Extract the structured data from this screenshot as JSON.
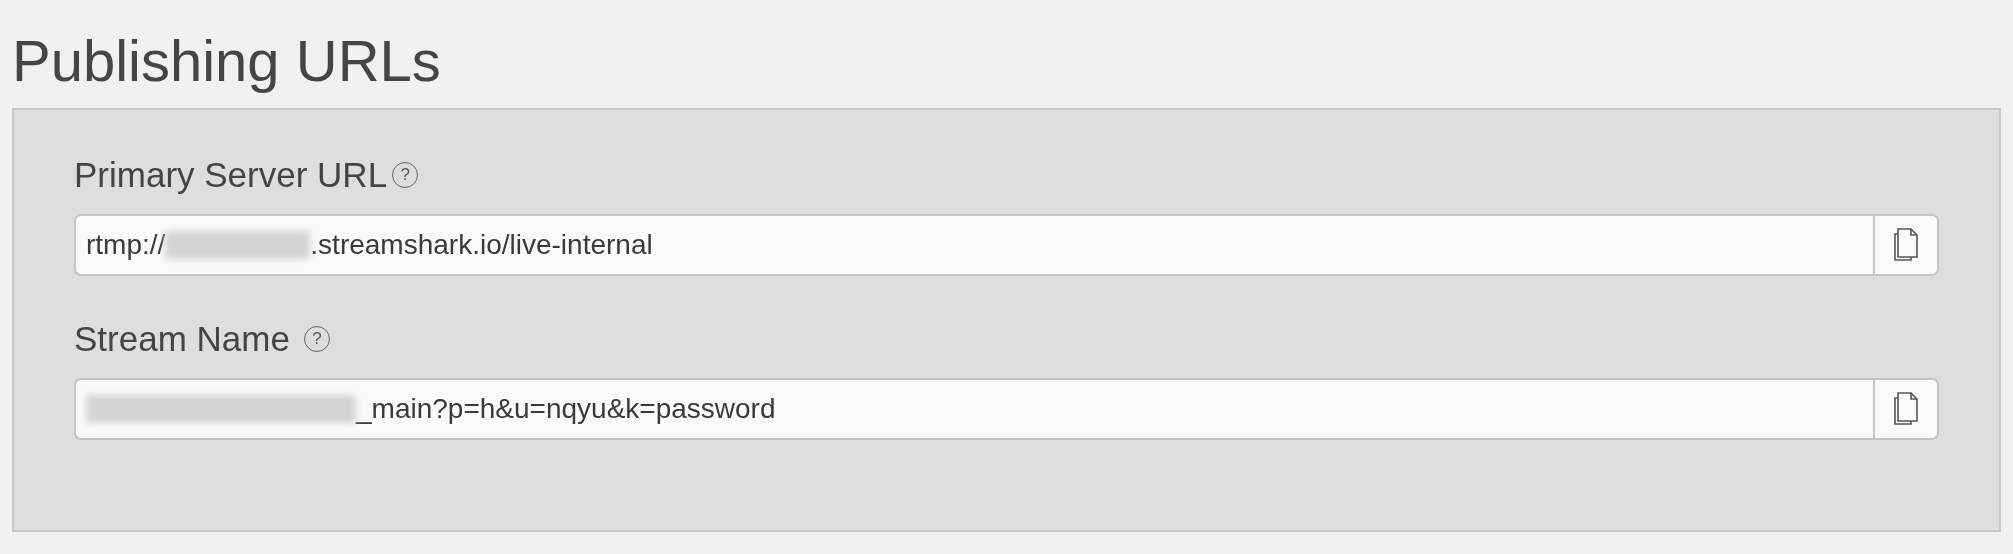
{
  "page_title": "Publishing URLs",
  "fields": [
    {
      "label": "Primary Server URL",
      "help": "?",
      "value_before": "rtmp://",
      "redacted": true,
      "value_after": ".streamshark.io/live-internal",
      "copy_button": true
    },
    {
      "label": "Stream Name",
      "help": "?",
      "redacted": true,
      "value_after": "_main?p=h&u=nqyu&k=password",
      "copy_button": true
    }
  ]
}
